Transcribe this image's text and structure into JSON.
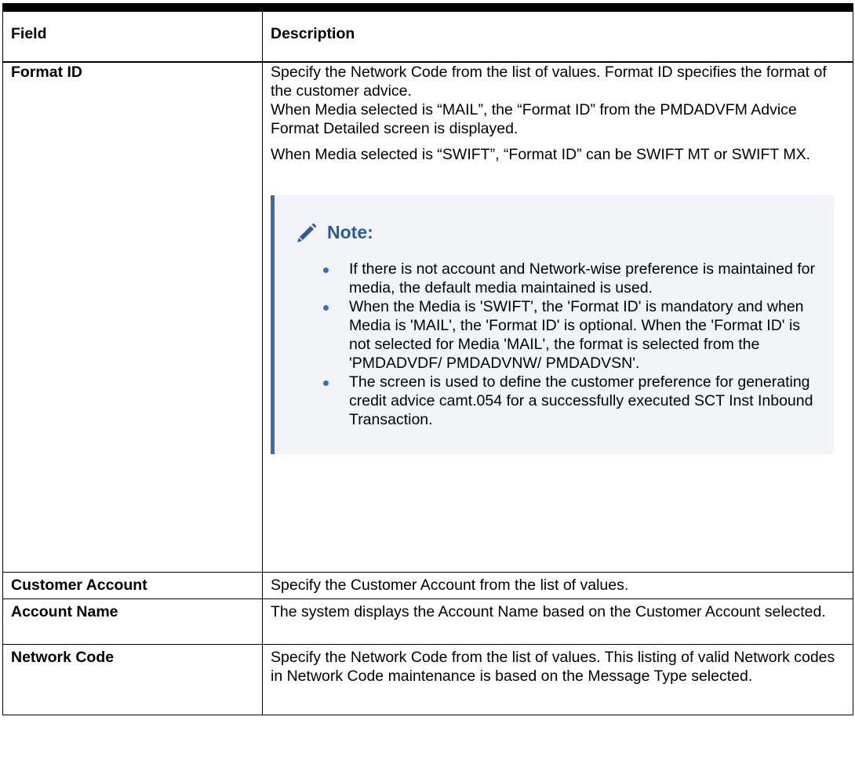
{
  "headers": {
    "field": "Field",
    "description": "Description"
  },
  "rows": [
    {
      "field": "Format ID",
      "paragraphs": [
        "Specify the Network Code from the list of values. Format ID specifies the format of the customer advice.",
        "When Media selected is “MAIL”, the “Format ID” from the PMDADVFM Advice Format Detailed screen is displayed.",
        "When Media selected is “SWIFT”, “Format ID” can be SWIFT MT or SWIFT MX."
      ],
      "note": {
        "title": "Note:",
        "icon": "pencil-icon",
        "items": [
          "If there is not account and Network-wise preference is maintained for media, the default media maintained is used.",
          "When the Media is 'SWIFT', the 'Format ID' is mandatory and when Media is 'MAIL', the 'Format ID' is optional. When the 'Format ID' is not selected for Media 'MAIL', the format is selected from the 'PMDADVDF/ PMDADVNW/ PMDADVSN'.",
          "The screen is used to define the customer preference for generating credit advice camt.054 for a successfully executed SCT Inst Inbound Transaction."
        ]
      }
    },
    {
      "field": "Customer Account",
      "paragraphs": [
        "Specify the Customer Account from the list of values."
      ]
    },
    {
      "field": "Account Name",
      "paragraphs": [
        "The system displays the Account Name based on the Customer Account selected."
      ]
    },
    {
      "field": "Network Code",
      "paragraphs": [
        "Specify the Network Code from the list of values. This listing of valid Network codes in Network Code maintenance is based on the Message Type selected."
      ]
    }
  ],
  "colors": {
    "note_accent": "#3d69b2",
    "note_background": "#f1f5fa",
    "note_title": "#2c5aa0",
    "bullet": "#3a6cc4"
  }
}
